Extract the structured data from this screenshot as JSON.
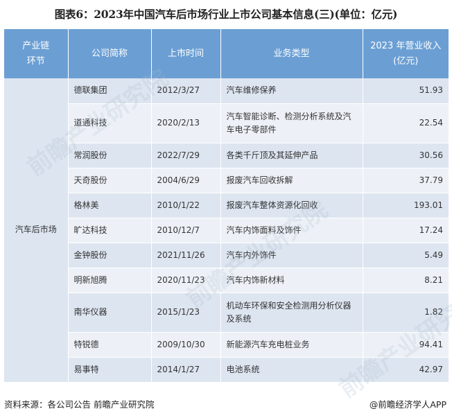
{
  "title": "图表6：2023年中国汽车后市场行业上市公司基本信息(三)(单位：亿元)",
  "table": {
    "headers": [
      "产业链环节",
      "公司简称",
      "上市时间",
      "业务类型",
      "2023 年营业收入(亿元)"
    ],
    "segment": "汽车后市场",
    "rows": [
      {
        "company": "德联集团",
        "date": "2012/3/27",
        "business": "汽车维修保养",
        "revenue": "51.93"
      },
      {
        "company": "道通科技",
        "date": "2020/2/13",
        "business": "汽车智能诊断、检测分析系统及汽车电子零部件",
        "revenue": "22.54"
      },
      {
        "company": "常润股份",
        "date": "2022/7/29",
        "business": "各类千斤顶及其延伸产品",
        "revenue": "30.56"
      },
      {
        "company": "天奇股份",
        "date": "2004/6/29",
        "business": "报废汽车回收拆解",
        "revenue": "37.79"
      },
      {
        "company": "格林美",
        "date": "2010/1/22",
        "business": "报废汽车整体资源化回收",
        "revenue": "193.01"
      },
      {
        "company": "旷达科技",
        "date": "2010/12/7",
        "business": "汽车内饰面料及饰件",
        "revenue": "17.24"
      },
      {
        "company": "金钟股份",
        "date": "2021/11/26",
        "business": "汽车内外饰件",
        "revenue": "5.49"
      },
      {
        "company": "明新旭腾",
        "date": "2020/11/23",
        "business": "汽车内饰新材料",
        "revenue": "8.21"
      },
      {
        "company": "南华仪器",
        "date": "2015/1/23",
        "business": "机动车环保和安全检测用分析仪器及系统",
        "revenue": "1.82"
      },
      {
        "company": "特锐德",
        "date": "2009/10/30",
        "business": "新能源汽车充电桩业务",
        "revenue": "94.41"
      },
      {
        "company": "易事特",
        "date": "2014/1/27",
        "business": "电池系统",
        "revenue": "42.97"
      }
    ]
  },
  "footer": {
    "source": "资料来源：各公司公告 前瞻产业研究院",
    "brand": "@前瞻经济学人APP"
  },
  "watermark": "前瞻产业研究院"
}
